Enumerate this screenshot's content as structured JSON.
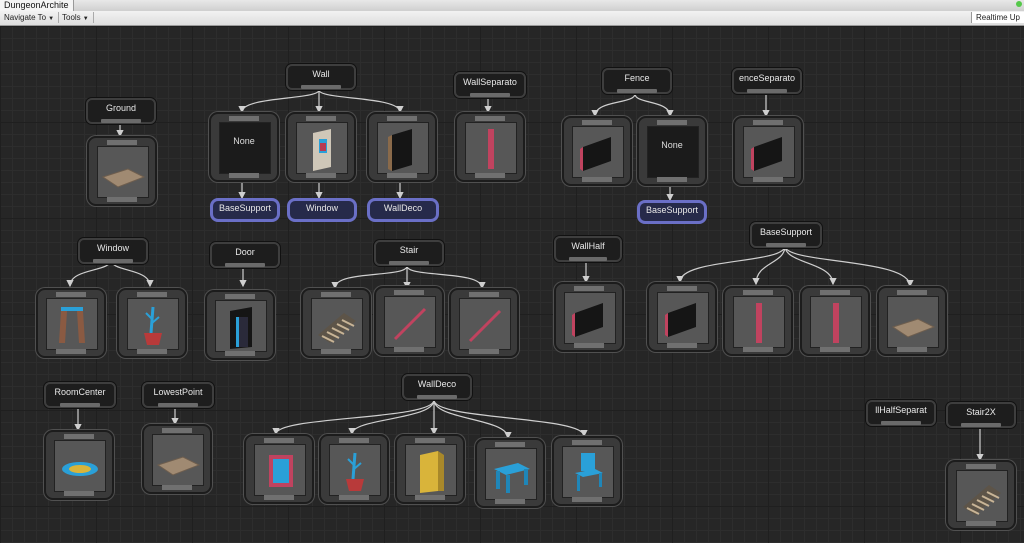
{
  "window": {
    "tab_title": "DungeonArchite"
  },
  "toolbar": {
    "navigate": "Navigate To",
    "tools": "Tools",
    "realtime": "Realtime Up"
  },
  "marker_nodes": {
    "ground": "Ground",
    "wall": "Wall",
    "wall_separator": "WallSeparato",
    "fence": "Fence",
    "fence_separator": "enceSeparato",
    "window": "Window",
    "door": "Door",
    "stair": "Stair",
    "wall_half": "WallHalf",
    "base_support": "BaseSupport",
    "room_center": "RoomCenter",
    "lowest_point": "LowestPoint",
    "wall_deco": "WallDeco",
    "wall_half_separator": "llHalfSeparat",
    "stair2x": "Stair2X"
  },
  "none_label": "None",
  "emit_nodes": {
    "base_support_1": "BaseSupport",
    "window": "Window",
    "wall_deco": "WallDeco",
    "base_support_2": "BaseSupport"
  },
  "colors": {
    "background": "#262626",
    "emitter_border": "#6a6fc6",
    "wall_red": "#b83a52",
    "pillar": "#c0435f",
    "blue_furniture": "#2aa0d8",
    "yellow": "#d9b43a"
  },
  "previews": [
    "floor-tile",
    "blank",
    "door-wall",
    "dark-wall",
    "pillar",
    "red-wall",
    "red-wall",
    "curtains",
    "plant",
    "door",
    "stair-flat",
    "stair-diag",
    "stair-diag",
    "red-wall",
    "red-wall",
    "pillar",
    "pillar",
    "floor-tile",
    "glow-disc",
    "floor-tile",
    "painting",
    "plant",
    "cabinet",
    "stool",
    "chair",
    "stair-flat"
  ]
}
